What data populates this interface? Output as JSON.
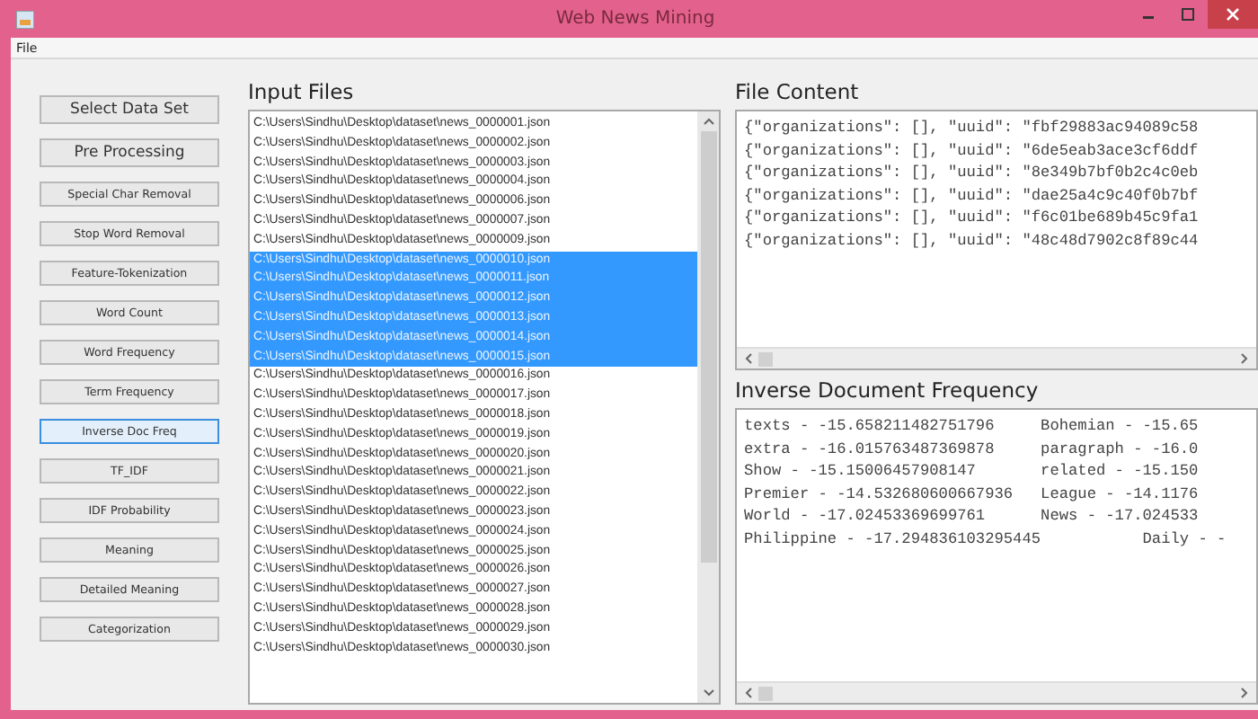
{
  "window": {
    "title": "Web News Mining"
  },
  "menu": [
    "File"
  ],
  "actions": [
    {
      "label": "Select Data Set",
      "kind": "large",
      "selected": false
    },
    {
      "label": "Pre Processing",
      "kind": "large",
      "selected": false
    },
    {
      "label": "Special Char Removal",
      "kind": "small",
      "selected": false
    },
    {
      "label": "Stop Word Removal",
      "kind": "small",
      "selected": false
    },
    {
      "label": "Feature-Tokenization",
      "kind": "small",
      "selected": false
    },
    {
      "label": "Word Count",
      "kind": "small",
      "selected": false
    },
    {
      "label": "Word Frequency",
      "kind": "small",
      "selected": false
    },
    {
      "label": "Term Frequency",
      "kind": "small",
      "selected": false
    },
    {
      "label": "Inverse Doc Freq",
      "kind": "small",
      "selected": true
    },
    {
      "label": "TF_IDF",
      "kind": "small",
      "selected": false
    },
    {
      "label": "IDF Probability",
      "kind": "small",
      "selected": false
    },
    {
      "label": "Meaning",
      "kind": "small",
      "selected": false
    },
    {
      "label": "Detailed Meaning",
      "kind": "small",
      "selected": false
    },
    {
      "label": "Categorization",
      "kind": "small",
      "selected": false
    }
  ],
  "input_files": {
    "title": "Input Files",
    "files": [
      {
        "path": "C:\\Users\\Sindhu\\Desktop\\dataset\\news_0000001.json",
        "selected": false
      },
      {
        "path": "C:\\Users\\Sindhu\\Desktop\\dataset\\news_0000002.json",
        "selected": false
      },
      {
        "path": "C:\\Users\\Sindhu\\Desktop\\dataset\\news_0000003.json",
        "selected": false
      },
      {
        "path": "C:\\Users\\Sindhu\\Desktop\\dataset\\news_0000004.json",
        "selected": false
      },
      {
        "path": "C:\\Users\\Sindhu\\Desktop\\dataset\\news_0000006.json",
        "selected": false
      },
      {
        "path": "C:\\Users\\Sindhu\\Desktop\\dataset\\news_0000007.json",
        "selected": false
      },
      {
        "path": "C:\\Users\\Sindhu\\Desktop\\dataset\\news_0000009.json",
        "selected": false
      },
      {
        "path": "C:\\Users\\Sindhu\\Desktop\\dataset\\news_0000010.json",
        "selected": true
      },
      {
        "path": "C:\\Users\\Sindhu\\Desktop\\dataset\\news_0000011.json",
        "selected": true
      },
      {
        "path": "C:\\Users\\Sindhu\\Desktop\\dataset\\news_0000012.json",
        "selected": true
      },
      {
        "path": "C:\\Users\\Sindhu\\Desktop\\dataset\\news_0000013.json",
        "selected": true
      },
      {
        "path": "C:\\Users\\Sindhu\\Desktop\\dataset\\news_0000014.json",
        "selected": true
      },
      {
        "path": "C:\\Users\\Sindhu\\Desktop\\dataset\\news_0000015.json",
        "selected": true
      },
      {
        "path": "C:\\Users\\Sindhu\\Desktop\\dataset\\news_0000016.json",
        "selected": false
      },
      {
        "path": "C:\\Users\\Sindhu\\Desktop\\dataset\\news_0000017.json",
        "selected": false
      },
      {
        "path": "C:\\Users\\Sindhu\\Desktop\\dataset\\news_0000018.json",
        "selected": false
      },
      {
        "path": "C:\\Users\\Sindhu\\Desktop\\dataset\\news_0000019.json",
        "selected": false
      },
      {
        "path": "C:\\Users\\Sindhu\\Desktop\\dataset\\news_0000020.json",
        "selected": false
      },
      {
        "path": "C:\\Users\\Sindhu\\Desktop\\dataset\\news_0000021.json",
        "selected": false
      },
      {
        "path": "C:\\Users\\Sindhu\\Desktop\\dataset\\news_0000022.json",
        "selected": false
      },
      {
        "path": "C:\\Users\\Sindhu\\Desktop\\dataset\\news_0000023.json",
        "selected": false
      },
      {
        "path": "C:\\Users\\Sindhu\\Desktop\\dataset\\news_0000024.json",
        "selected": false
      },
      {
        "path": "C:\\Users\\Sindhu\\Desktop\\dataset\\news_0000025.json",
        "selected": false
      },
      {
        "path": "C:\\Users\\Sindhu\\Desktop\\dataset\\news_0000026.json",
        "selected": false
      },
      {
        "path": "C:\\Users\\Sindhu\\Desktop\\dataset\\news_0000027.json",
        "selected": false
      },
      {
        "path": "C:\\Users\\Sindhu\\Desktop\\dataset\\news_0000028.json",
        "selected": false
      },
      {
        "path": "C:\\Users\\Sindhu\\Desktop\\dataset\\news_0000029.json",
        "selected": false
      },
      {
        "path": "C:\\Users\\Sindhu\\Desktop\\dataset\\news_0000030.json",
        "selected": false
      }
    ]
  },
  "file_content": {
    "title": "File Content",
    "lines": [
      "{\"organizations\": [], \"uuid\": \"fbf29883ac94089c58",
      "{\"organizations\": [], \"uuid\": \"6de5eab3ace3cf6ddf",
      "{\"organizations\": [], \"uuid\": \"8e349b7bf0b2c4c0eb",
      "{\"organizations\": [], \"uuid\": \"dae25a4c9c40f0b7bf",
      "{\"organizations\": [], \"uuid\": \"f6c01be689b45c9fa1",
      "{\"organizations\": [], \"uuid\": \"48c48d7902c8f89c44"
    ]
  },
  "idf": {
    "title": "Inverse Document Frequency",
    "lines": [
      "texts - -15.658211482751796\tBohemian - -15.65",
      "extra - -16.015763487369878\tparagraph - -16.0",
      "Show - -15.15006457908147\trelated - -15.150",
      "Premier - -14.532680600667936\tLeague - -14.1176",
      "World - -17.02453369699761\tNews - -17.024533",
      "Philippine - -17.294836103295445\t   Daily - -"
    ]
  }
}
